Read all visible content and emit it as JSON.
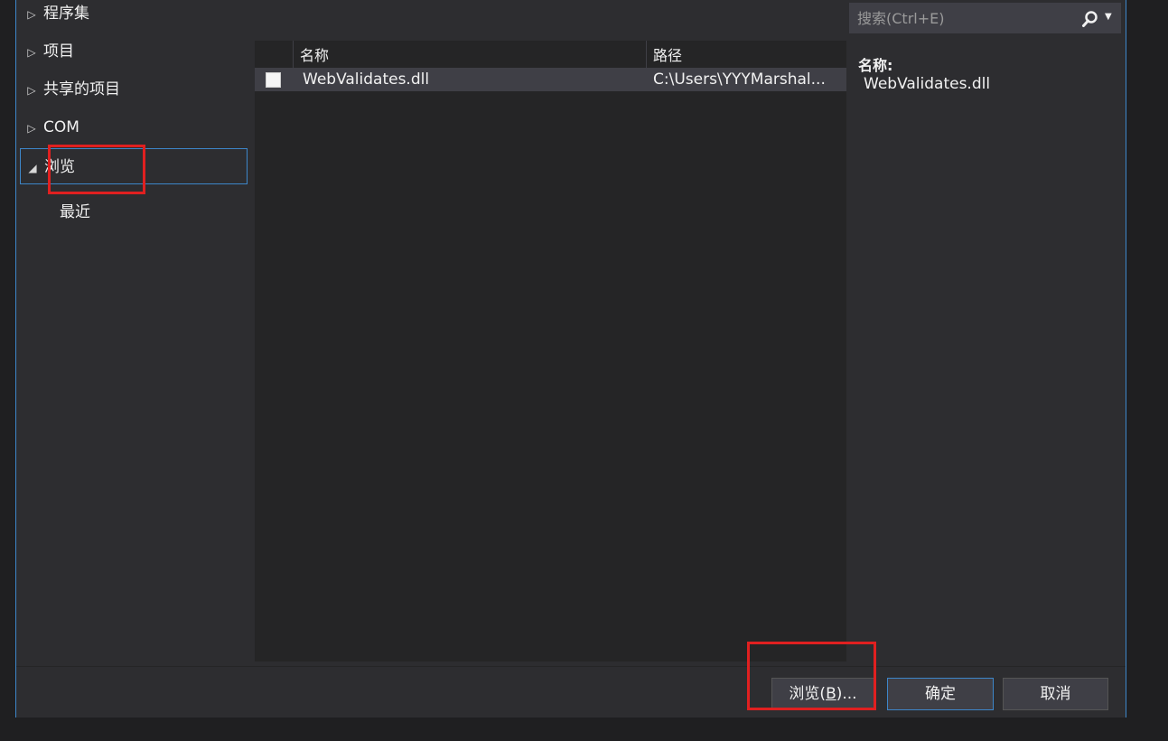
{
  "tree": {
    "items": [
      {
        "arrow": "▷",
        "label": "程序集"
      },
      {
        "arrow": "▷",
        "label": "项目"
      },
      {
        "arrow": "▷",
        "label": "共享的项目"
      },
      {
        "arrow": "▷",
        "label": "COM"
      },
      {
        "arrow": "◢",
        "label": "浏览"
      }
    ],
    "sub_item": "最近"
  },
  "list": {
    "columns": {
      "name": "名称",
      "path": "路径"
    },
    "rows": [
      {
        "name": "WebValidates.dll",
        "path": "C:\\Users\\YYYMarshal...",
        "checked": false
      }
    ]
  },
  "search": {
    "placeholder": "搜索(Ctrl+E)",
    "icon": "search-icon"
  },
  "details": {
    "name_label": "名称:",
    "name_value": "WebValidates.dll"
  },
  "footer": {
    "browse_label": "浏览(",
    "browse_key": "B",
    "browse_suffix": ")...",
    "ok_label": "确定",
    "cancel_label": "取消"
  },
  "colors": {
    "accent": "#3d86c9",
    "annotation": "#e02020",
    "background": "#2d2d30"
  }
}
